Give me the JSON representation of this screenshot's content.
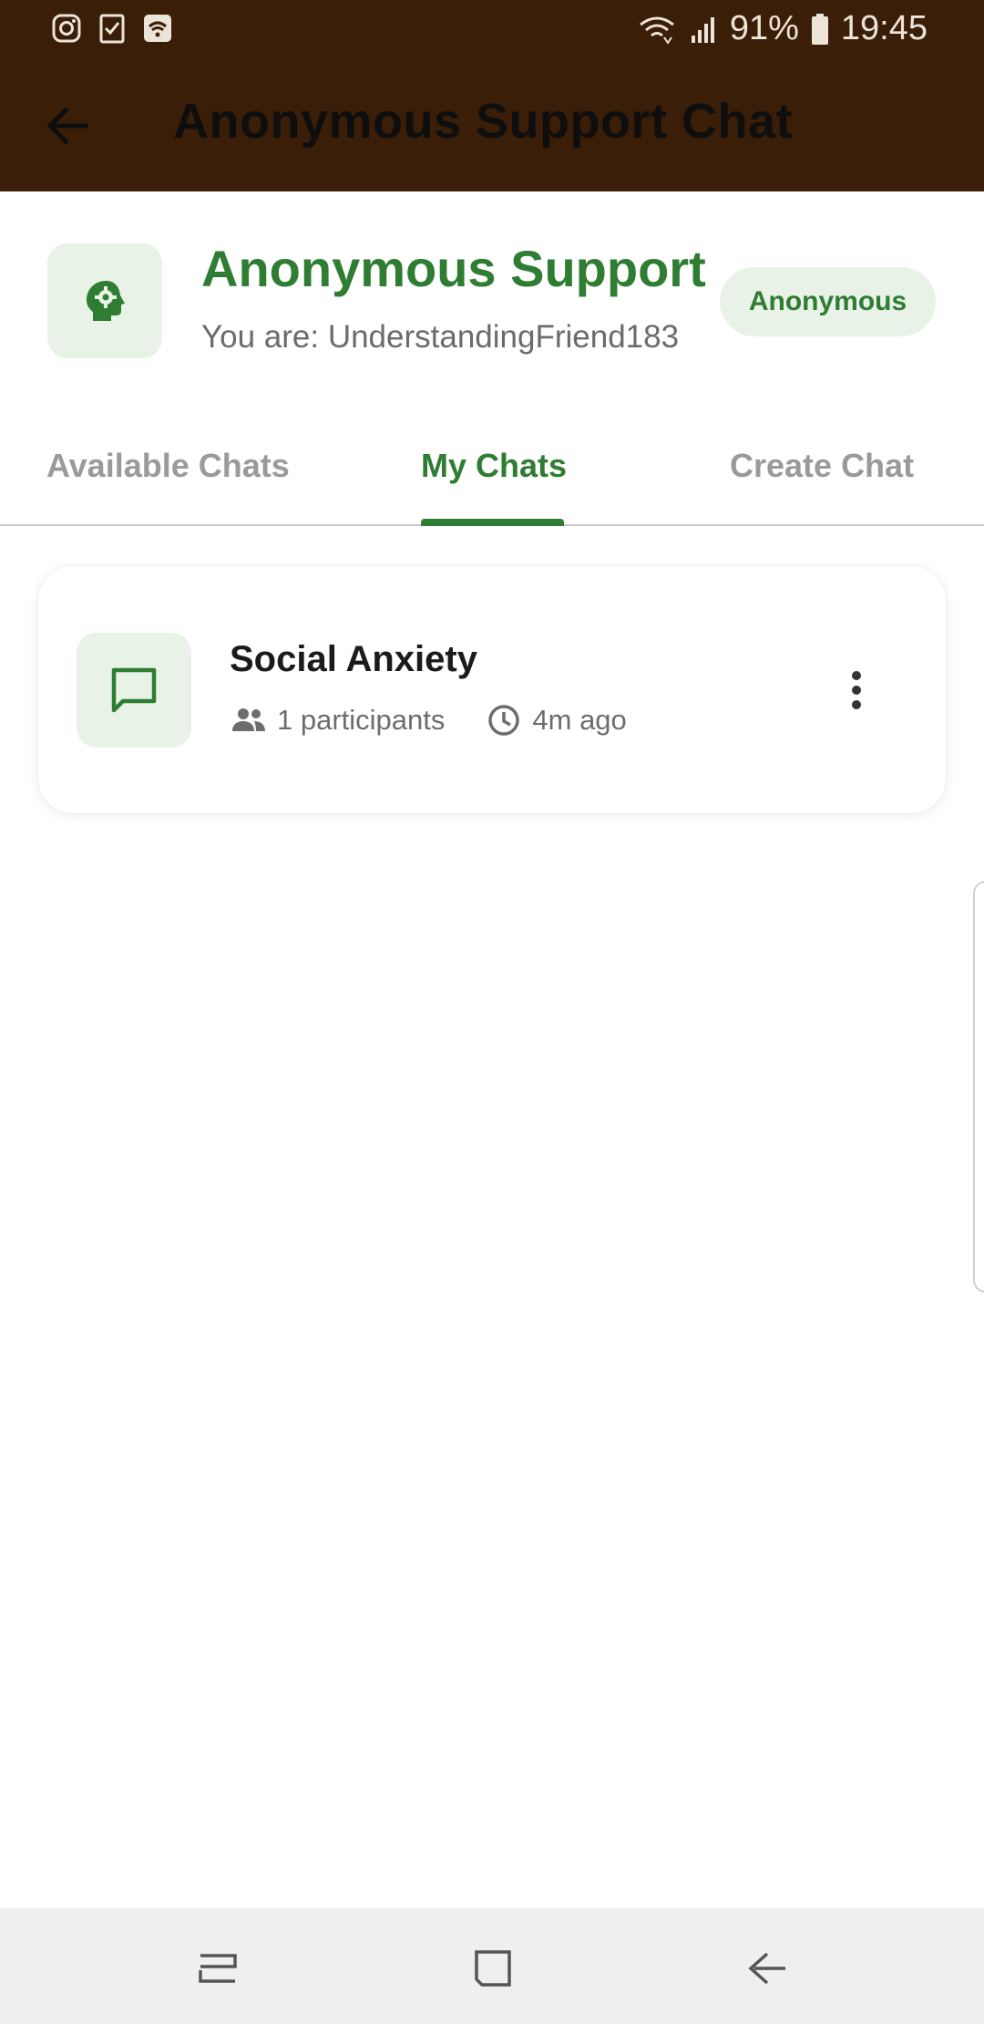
{
  "status_bar": {
    "icons_left": [
      "instagram-icon",
      "checklist-icon",
      "wifi-app-icon"
    ],
    "battery_percent": "91%",
    "time": "19:45"
  },
  "app_bar": {
    "title": "Anonymous Support Chat",
    "back_icon": "arrow-back-icon"
  },
  "profile": {
    "icon": "psychology-head-icon",
    "title": "Anonymous Support",
    "subtitle": "You are: UnderstandingFriend183",
    "badge": "Anonymous"
  },
  "tabs": [
    {
      "label": "Available Chats",
      "active": false
    },
    {
      "label": "My Chats",
      "active": true
    },
    {
      "label": "Create Chat",
      "active": false
    }
  ],
  "chats": [
    {
      "icon": "chat-bubble-icon",
      "title": "Social Anxiety",
      "participants": "1 participants",
      "time": "4m ago"
    }
  ],
  "colors": {
    "accent": "#2e7d32",
    "accent_bg": "#e8f2e7",
    "app_bar_bg": "#3a1e07"
  }
}
